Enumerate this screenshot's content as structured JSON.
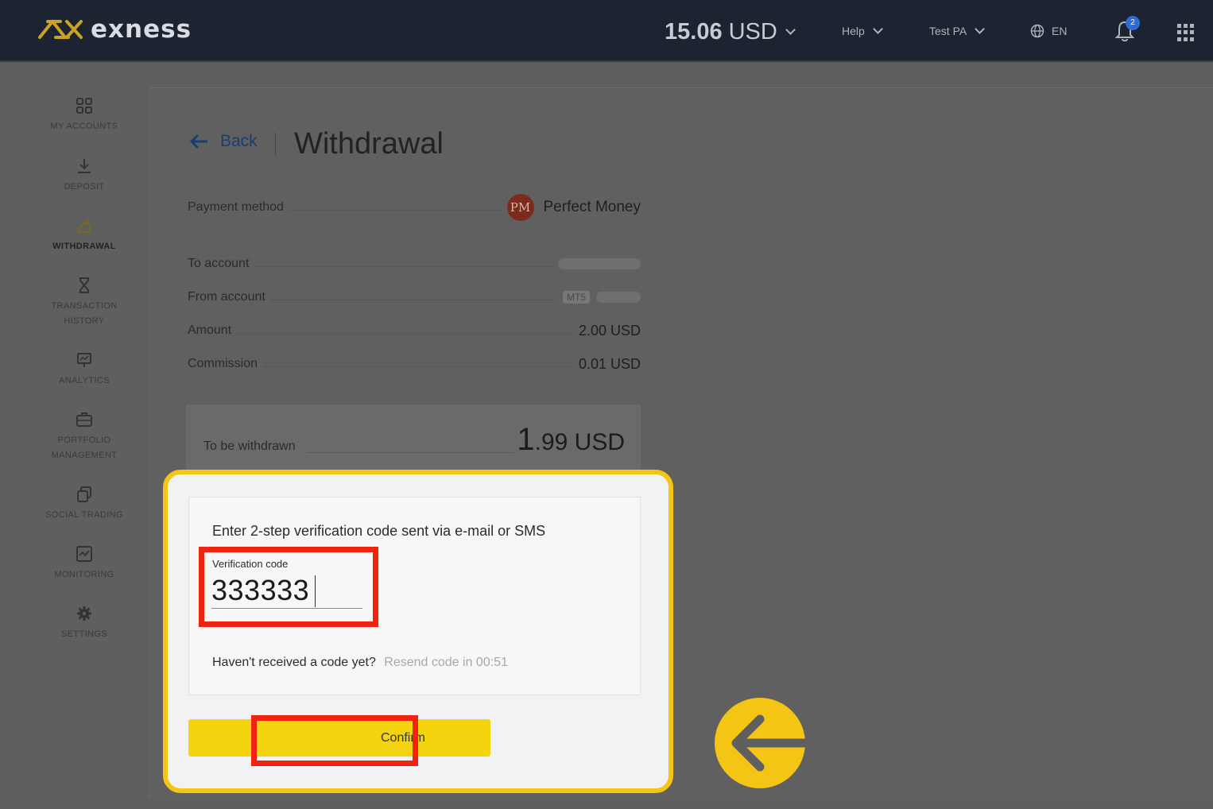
{
  "header": {
    "logo_text": "exness",
    "balance_amount": "15.06",
    "balance_currency": "USD",
    "help_label": "Help",
    "account_label": "Test PA",
    "language": "EN",
    "notifications_count": "2"
  },
  "sidebar": {
    "items": [
      {
        "label": "MY ACCOUNTS",
        "icon": "grid-icon"
      },
      {
        "label": "DEPOSIT",
        "icon": "download-icon"
      },
      {
        "label": "WITHDRAWAL",
        "icon": "upload-icon",
        "active": true
      },
      {
        "label": "TRANSACTION HISTORY",
        "icon": "hourglass-icon"
      },
      {
        "label": "ANALYTICS",
        "icon": "presentation-icon"
      },
      {
        "label": "PORTFOLIO MANAGEMENT",
        "icon": "briefcase-icon"
      },
      {
        "label": "SOCIAL TRADING",
        "icon": "copy-icon"
      },
      {
        "label": "MONITORING",
        "icon": "chart-icon"
      },
      {
        "label": "SETTINGS",
        "icon": "gear-icon"
      }
    ]
  },
  "page": {
    "back_label": "Back",
    "title": "Withdrawal",
    "payment_method_label": "Payment method",
    "payment_method_logo": "PM",
    "payment_method_value": "Perfect Money",
    "to_account_label": "To account",
    "from_account_label": "From account",
    "from_account_badge": "MT5",
    "amount_label": "Amount",
    "amount_value": "2.00 USD",
    "commission_label": "Commission",
    "commission_value": "0.01 USD",
    "to_be_withdrawn_label": "To be withdrawn",
    "to_be_withdrawn_int": "1",
    "to_be_withdrawn_rest": ".99 USD"
  },
  "verification": {
    "prompt": "Enter 2-step verification code sent via e-mail or SMS",
    "code_label": "Verification code",
    "code_value": "333333",
    "resend_question": "Haven't received a code yet?",
    "resend_timer": "Resend code in 00:51",
    "confirm_label": "Confirm"
  },
  "colors": {
    "highlight_yellow": "#f4c515",
    "annotation_red": "#f2230e",
    "button_yellow": "#f4d40f"
  }
}
